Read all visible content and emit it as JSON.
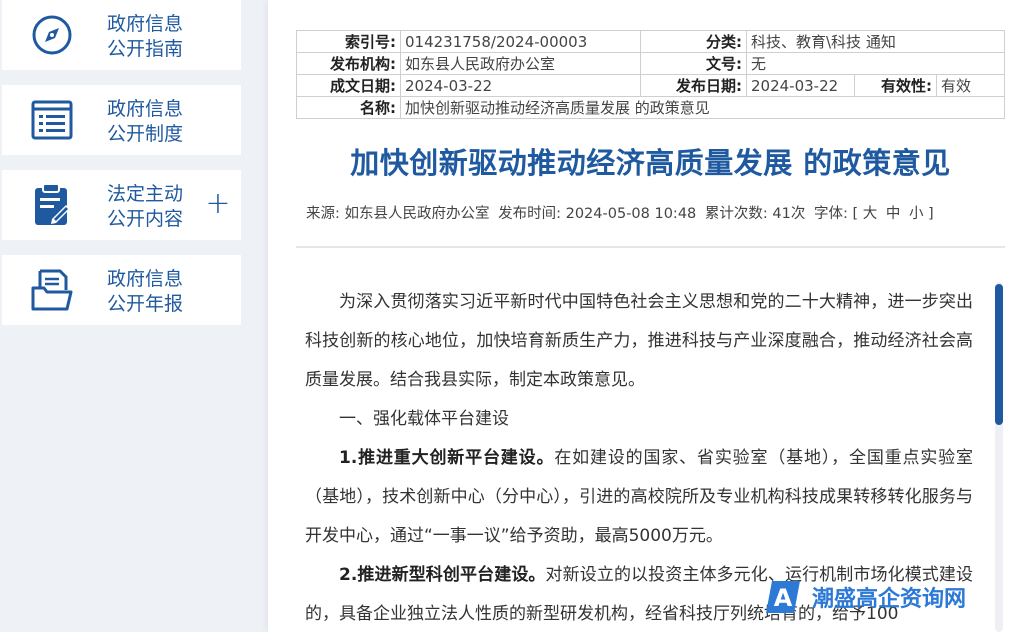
{
  "sidebar": {
    "items": [
      {
        "line1": "政府信息",
        "line2": "公开指南",
        "icon": "compass-icon"
      },
      {
        "line1": "政府信息",
        "line2": "公开制度",
        "icon": "list-icon"
      },
      {
        "line1": "法定主动",
        "line2": "公开内容",
        "icon": "clipboard-edit-icon",
        "expand": "+"
      },
      {
        "line1": "政府信息",
        "line2": "公开年报",
        "icon": "folder-document-icon"
      }
    ]
  },
  "meta": {
    "index_label": "索引号:",
    "index_value": "014231758/2024-00003",
    "category_label": "分类:",
    "category_value": "科技、教育\\科技    通知",
    "org_label": "发布机构:",
    "org_value": "如东县人民政府办公室",
    "docno_label": "文号:",
    "docno_value": "无",
    "created_label": "成文日期:",
    "created_value": "2024-03-22",
    "published_label": "发布日期:",
    "published_value": "2024-03-22",
    "validity_label": "有效性:",
    "validity_value": "有效",
    "name_label": "名称:",
    "name_value": "加快创新驱动推动经济高质量发展 的政策意见"
  },
  "document": {
    "title": "加快创新驱动推动经济高质量发展 的政策意见",
    "source": "来源: 如东县人民政府办公室",
    "publish_time": "发布时间: 2024-05-08 10:48",
    "views": "累计次数: 41次",
    "font_size_label": "字体: [",
    "font_large": "大",
    "font_medium": "中",
    "font_small": "小",
    "font_close": "]",
    "para1": "为深入贯彻落实习近平新时代中国特色社会主义思想和党的二十大精神，进一步突出科技创新的核心地位，加快培育新质生产力，推进科技与产业深度融合，推动经济社会高质量发展。结合我县实际，制定本政策意见。",
    "section1": "一、强化载体平台建设",
    "item1_title": "1.推进重大创新平台建设。",
    "item1_text": "在如建设的国家、省实验室（基地），全国重点实验室（基地），技术创新中心（分中心），引进的高校院所及专业机构科技成果转移转化服务与开发中心，通过“一事一议”给予资助，最高5000万元。",
    "item2_title": "2.推进新型科创平台建设。",
    "item2_text": "对新设立的以投资主体多元化、运行机制市场化模式建设的，具备企业独立法人性质的新型研发机构，经省科技厅列统培育的，给予100"
  },
  "watermark": {
    "text": "潮盛高企资询网"
  },
  "colors": {
    "accent": "#1f5aa0",
    "watermark": "#2d79d6"
  }
}
